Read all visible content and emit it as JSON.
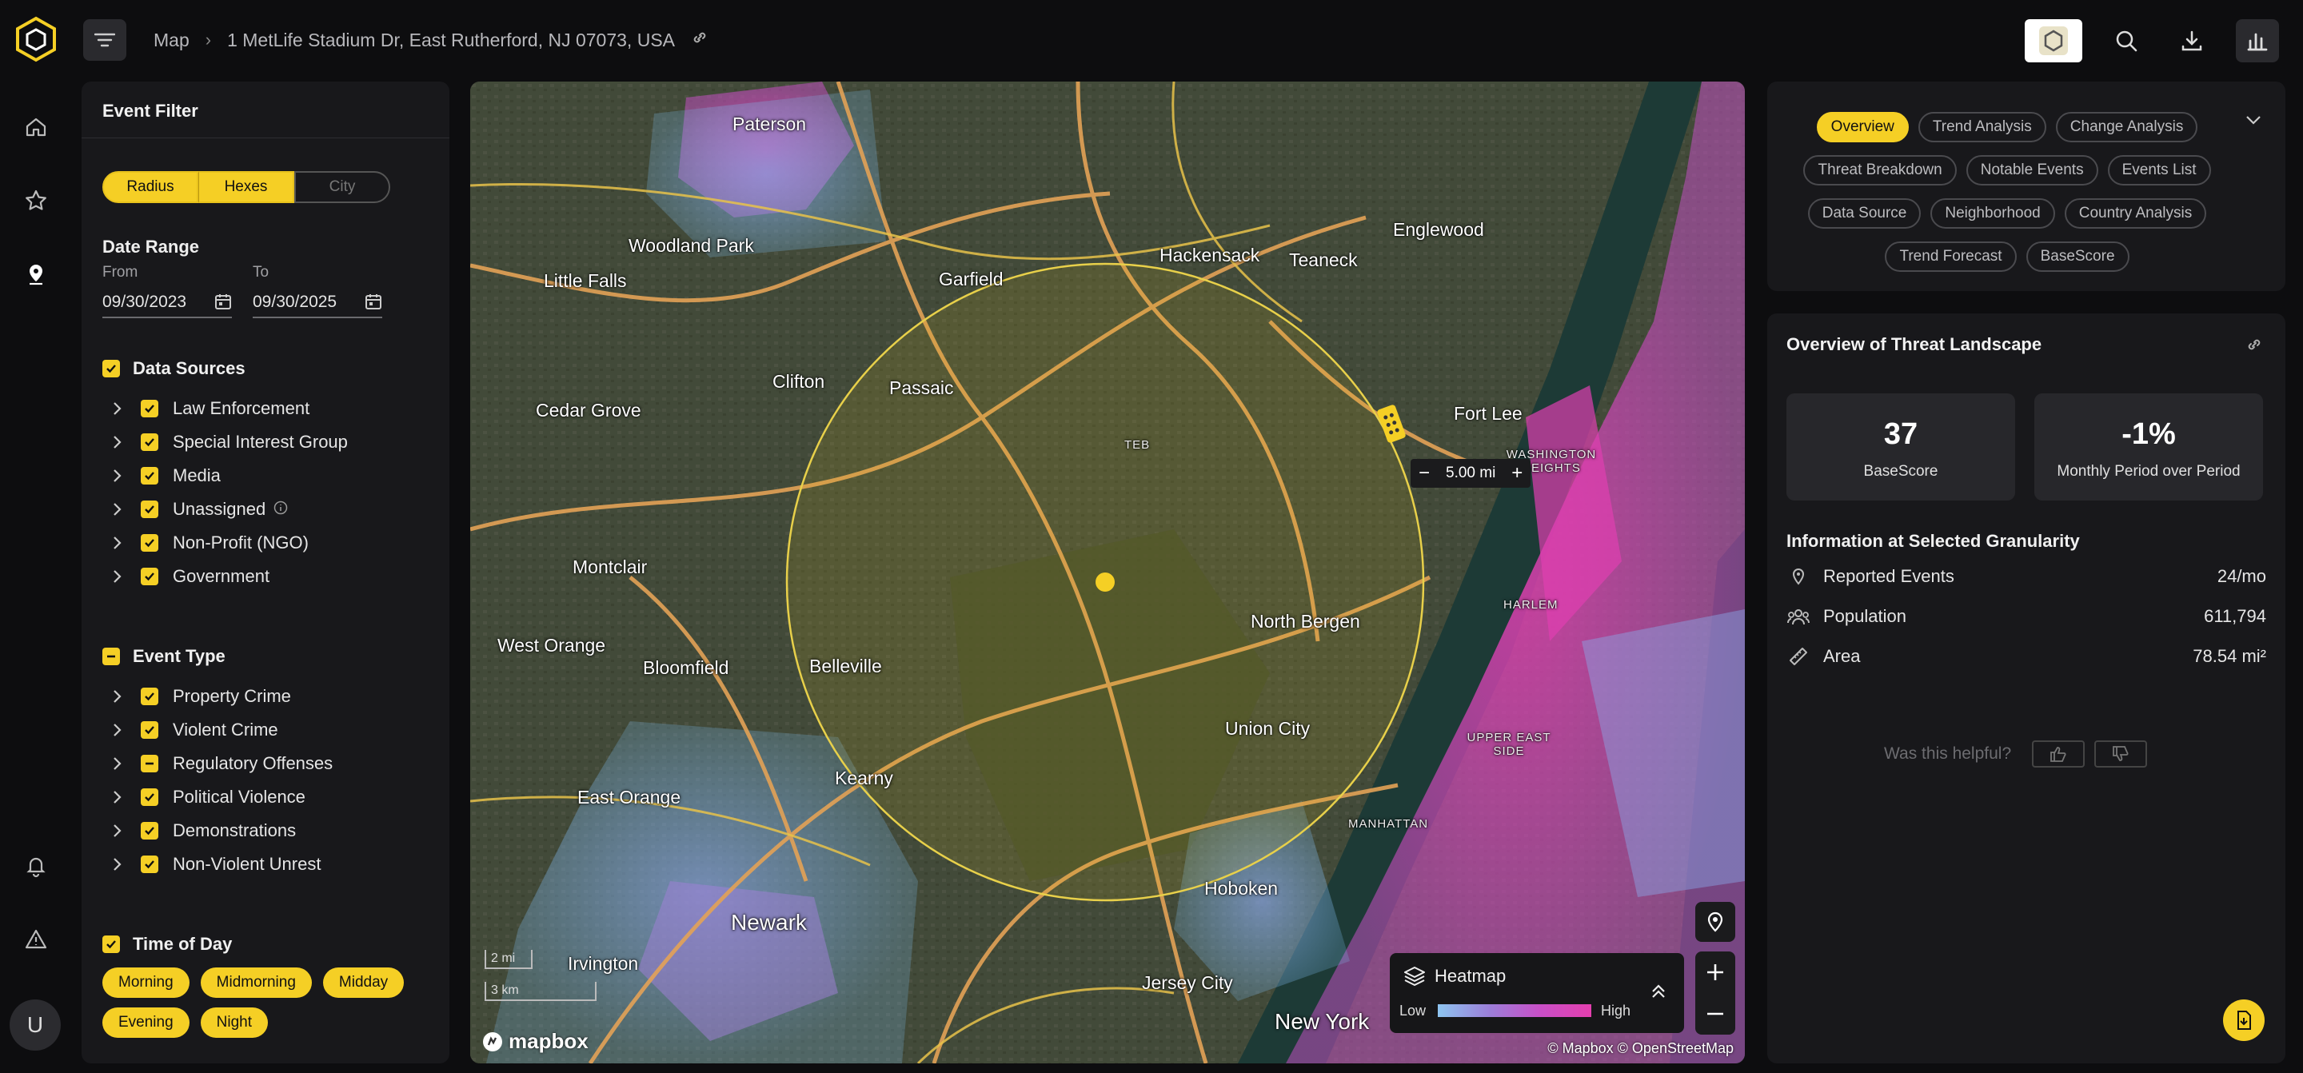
{
  "header": {
    "breadcrumb_root": "Map",
    "breadcrumb_address": "1 MetLife Stadium Dr, East Rutherford, NJ 07073, USA"
  },
  "rail": {
    "avatar_initial": "U"
  },
  "filter": {
    "title": "Event Filter",
    "modes": [
      "Radius",
      "Hexes",
      "City"
    ],
    "date_range": {
      "title": "Date Range",
      "from_label": "From",
      "to_label": "To",
      "from_value": "09/30/2023",
      "to_value": "09/30/2025"
    },
    "data_sources": {
      "title": "Data Sources",
      "items": [
        "Law Enforcement",
        "Special Interest Group",
        "Media",
        "Unassigned",
        "Non-Profit (NGO)",
        "Government"
      ]
    },
    "event_type": {
      "title": "Event Type",
      "items": [
        "Property Crime",
        "Violent Crime",
        "Regulatory Offenses",
        "Political Violence",
        "Demonstrations",
        "Non-Violent Unrest"
      ]
    },
    "time_of_day": {
      "title": "Time of Day",
      "chips": [
        "Morning",
        "Midmorning",
        "Midday",
        "Evening",
        "Night"
      ]
    }
  },
  "map": {
    "radius_value": "5.00 mi",
    "legend": {
      "title": "Heatmap",
      "low": "Low",
      "high": "High"
    },
    "attribution": "© Mapbox  © OpenStreetMap",
    "logo": "mapbox",
    "scale_top": "2 mi",
    "scale_bottom": "3 km",
    "places": {
      "paterson": "Paterson",
      "woodland_park": "Woodland Park",
      "little_falls": "Little Falls",
      "garfield": "Garfield",
      "hackensack": "Hackensack",
      "teaneck": "Teaneck",
      "englewood": "Englewood",
      "clifton": "Clifton",
      "passaic": "Passaic",
      "cedar_grove": "Cedar Grove",
      "fort_lee": "Fort Lee",
      "teb": "TEB",
      "washington_heights": "WASHINGTON HEIGHTS",
      "montclair": "Montclair",
      "west_orange": "West Orange",
      "bloomfield": "Bloomfield",
      "belleville": "Belleville",
      "north_bergen": "North Bergen",
      "harlem": "HARLEM",
      "union_city": "Union City",
      "upper_east_side": "UPPER EAST SIDE",
      "kearny": "Kearny",
      "east_orange": "East Orange",
      "manhattan": "MANHATTAN",
      "hoboken": "Hoboken",
      "newark": "Newark",
      "irvington": "Irvington",
      "jersey_city": "Jersey City",
      "new_york": "New York"
    }
  },
  "right": {
    "tabs": [
      "Overview",
      "Trend Analysis",
      "Change Analysis",
      "Threat Breakdown",
      "Notable Events",
      "Events List",
      "Data Source",
      "Neighborhood",
      "Country Analysis",
      "Trend Forecast",
      "BaseScore"
    ],
    "overview_title": "Overview of Threat Landscape",
    "stats": [
      {
        "value": "37",
        "label": "BaseScore"
      },
      {
        "value": "-1%",
        "label": "Monthly Period over Period"
      }
    ],
    "granularity_title": "Information at Selected Granularity",
    "info": [
      {
        "label": "Reported Events",
        "value": "24/mo"
      },
      {
        "label": "Population",
        "value": "611,794"
      },
      {
        "label": "Area",
        "value": "78.54 mi²"
      }
    ],
    "helpful": "Was this helpful?"
  },
  "colors": {
    "accent": "#f5cf25",
    "panel": "#18181b",
    "background": "#0d0d0f"
  }
}
